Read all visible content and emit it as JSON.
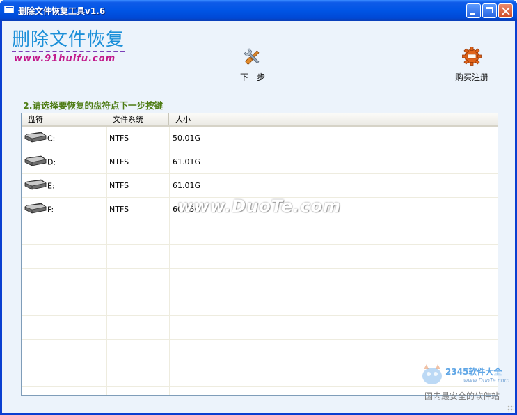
{
  "window": {
    "title": "删除文件恢复工具v1.6"
  },
  "logo": {
    "title": "删除文件恢复",
    "url": "www.91huifu.com"
  },
  "toolbar": {
    "next": {
      "label": "下一步",
      "icon": "tools-icon"
    },
    "buy": {
      "label": "购买注册",
      "icon": "gear-icon"
    }
  },
  "instruction": "2.请选择要恢复的盘符点下一步按键",
  "table": {
    "columns": [
      "盘符",
      "文件系统",
      "大小"
    ],
    "rows": [
      {
        "drive": "C:",
        "fs": "NTFS",
        "size": "50.01G"
      },
      {
        "drive": "D:",
        "fs": "NTFS",
        "size": "61.01G"
      },
      {
        "drive": "E:",
        "fs": "NTFS",
        "size": "61.01G"
      },
      {
        "drive": "F:",
        "fs": "NTFS",
        "size": "60.85G"
      }
    ]
  },
  "watermarks": {
    "duote": "www.DuoTe.com",
    "brand": "2345软件大全",
    "brand_url": "www.DuoTe.com",
    "site": "国内最安全的软件站"
  }
}
